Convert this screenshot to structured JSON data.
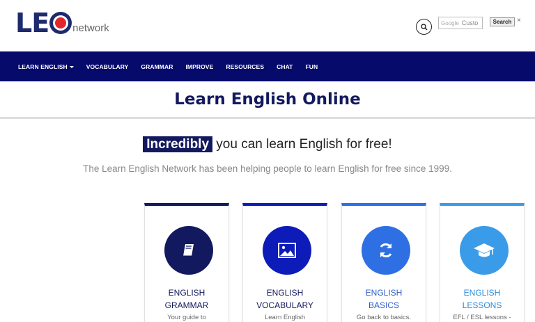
{
  "header": {
    "logo_main": "LE",
    "logo_sub": "network",
    "search": {
      "google_label": "Google",
      "input_value": "Custo",
      "button": "Search",
      "close": "×"
    }
  },
  "nav": {
    "items": [
      {
        "label": "LEARN ENGLISH",
        "dropdown": true
      },
      {
        "label": "VOCABULARY"
      },
      {
        "label": "GRAMMAR"
      },
      {
        "label": "IMPROVE"
      },
      {
        "label": "RESOURCES"
      },
      {
        "label": "CHAT"
      },
      {
        "label": "FUN"
      }
    ]
  },
  "main": {
    "title": "Learn English Online",
    "headline_highlight": "Incredibly",
    "headline_rest": " you can learn English for free!",
    "subline": "The Learn English Network has been helping people to learn English for free since 1999."
  },
  "cards": [
    {
      "line1": "ENGLISH",
      "line2": "GRAMMAR",
      "desc": "Your guide to",
      "icon": "book-icon",
      "color": "#13195e",
      "text_color": "#13195e"
    },
    {
      "line1": "ENGLISH",
      "line2": "VOCABULARY",
      "desc": "Learn English",
      "icon": "image-icon",
      "color": "#0d1cb8",
      "text_color": "#13195e"
    },
    {
      "line1": "ENGLISH",
      "line2": "BASICS",
      "desc": "Go back to basics.",
      "icon": "refresh-icon",
      "color": "#2f6fe4",
      "text_color": "#2f5fc9"
    },
    {
      "line1": "ENGLISH",
      "line2": "LESSONS",
      "desc": "EFL / ESL lessons -",
      "icon": "graduation-cap-icon",
      "color": "#3a9be8",
      "text_color": "#2c8bd9"
    }
  ]
}
